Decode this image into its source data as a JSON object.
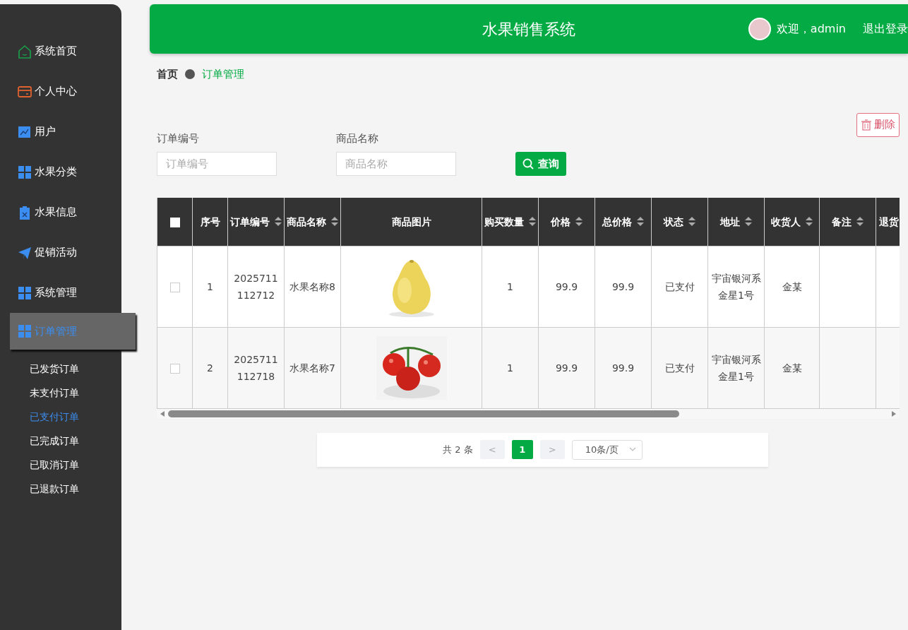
{
  "sidebar": {
    "items": [
      {
        "label": "系统首页",
        "selected": false
      },
      {
        "label": "个人中心",
        "selected": false
      },
      {
        "label": "用户",
        "selected": false
      },
      {
        "label": "水果分类",
        "selected": false
      },
      {
        "label": "水果信息",
        "selected": false
      },
      {
        "label": "促销活动",
        "selected": false
      },
      {
        "label": "系统管理",
        "selected": false
      },
      {
        "label": "订单管理",
        "selected": true,
        "children": [
          {
            "label": "已发货订单",
            "selected": false
          },
          {
            "label": "未支付订单",
            "selected": false
          },
          {
            "label": "已支付订单",
            "selected": true
          },
          {
            "label": "已完成订单",
            "selected": false
          },
          {
            "label": "已取消订单",
            "selected": false
          },
          {
            "label": "已退款订单",
            "selected": false
          }
        ]
      }
    ]
  },
  "header": {
    "title": "水果销售系统",
    "welcome": "欢迎，admin",
    "logout": "退出登录"
  },
  "breadcrumb": [
    "首页",
    "订单管理"
  ],
  "search": {
    "fields": [
      {
        "label": "订单编号",
        "placeholder": "订单编号"
      },
      {
        "label": "商品名称",
        "placeholder": "商品名称"
      }
    ],
    "query_button": "查询",
    "delete_button": "删除"
  },
  "table": {
    "select_all": {
      "checked": false
    },
    "columns": [
      {
        "label": "序号",
        "sortable": false
      },
      {
        "label": "订单编号",
        "sortable": true
      },
      {
        "label": "商品名称",
        "sortable": true
      },
      {
        "label": "商品图片",
        "sortable": false
      },
      {
        "label": "购买数量",
        "sortable": true
      },
      {
        "label": "价格",
        "sortable": true
      },
      {
        "label": "总价格",
        "sortable": true
      },
      {
        "label": "状态",
        "sortable": true
      },
      {
        "label": "地址",
        "sortable": true
      },
      {
        "label": "收货人",
        "sortable": true
      },
      {
        "label": "备注",
        "sortable": true
      },
      {
        "label": "退货",
        "sortable": false
      }
    ],
    "rows": [
      {
        "checked": false,
        "cells": [
          "1",
          "2025711112712",
          "水果名称8",
          {
            "kind": "picture"
          },
          "1",
          "99.9",
          "99.9",
          "已支付",
          "宇宙银河系金星1号",
          "金某",
          "",
          ""
        ]
      },
      {
        "checked": false,
        "cells": [
          "2",
          "2025711112718",
          "水果名称7",
          {
            "kind": "picture"
          },
          "1",
          "99.9",
          "99.9",
          "已支付",
          "宇宙银河系金星1号",
          "金某",
          "",
          ""
        ]
      }
    ]
  },
  "pagination": {
    "total": "共 2 条",
    "prev": "<",
    "pages": [
      {
        "label": "1",
        "selected": true
      }
    ],
    "next": ">",
    "page_size": "10条/页"
  }
}
